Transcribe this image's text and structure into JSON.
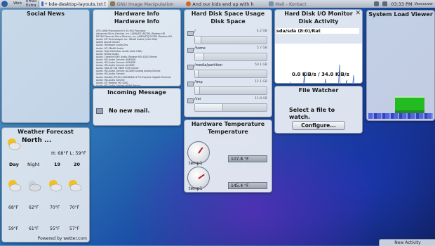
{
  "taskbar": {
    "k_menu": "K Menu",
    "web_label": "Web",
    "email_label": "Email",
    "extra_label": "Extra",
    "tasks": [
      "* kde-desktop-layouts.txt [",
      "GNU Image Manipulation ",
      "And our kids end up with h",
      "Mail - Kontact"
    ],
    "time": "03:33 PM",
    "location": "Vancouver"
  },
  "social_news": {
    "title": "Social News"
  },
  "hardware_info": {
    "titles": [
      "Hardware Info",
      "Hardware Info"
    ],
    "lines": [
      "CPU:    AMD Phenom(tm) II X4 945 Processor",
      "         Advanced Micro Devices, Inc. [AMD/ATI] RS780 (Radeon HD",
      "         RS780 Ethernet Micro Devices, Inc. [AMD/ATI] RS780 (Radeon HD",
      "Audio:  ATI Technologies Inc. SBx00 Azalia (Intel HDA)",
      "         Azalia Sound Device",
      "Audio:  Hardware Audio Dev",
      "Audio:  ATI SBx00 Azalia",
      "Audio:  High Definition Audio (Intel HDA)",
      "Audio:  Nvidia Audio",
      "Audio:  Creative EMU Audio (Radeon HD 4200) Series",
      "Audio:  HD-Audio Generic HDMI/DP",
      "Audio:  HD-Audio Generic HDMI/DP",
      "Audio:  HD-Audio Generic ALC889",
      "Audio:  HDA ATI SB HDMI PCM Device",
      "Audio:  HD-Audio Generic ALC889 Analog analog Device",
      "Audio:  HD-Audio Generic",
      "Audio:  Realtek RTL8111/8168/8411 PCI Express Gigabit Ethernet",
      "Audio:  HD-Audio Generic",
      "Audio:  ATI Radeon HD 4200",
      "Audio:  HD-Audio Generic HDMI Device",
      "Audio:  HD-Audio Generic"
    ]
  },
  "disk_space": {
    "titles": [
      "Hard Disk Space Usage",
      "Disk Space"
    ],
    "rows": [
      {
        "name": "/",
        "value": "4.2 GB",
        "used": 0.08
      },
      {
        "name": "/home",
        "value": "5.7 GB",
        "used": 0.12
      },
      {
        "name": "/media/partition",
        "value": "50.1 GB",
        "used": 0.0
      },
      {
        "name": "/tmp",
        "value": "12.1 GB",
        "used": 0.06
      },
      {
        "name": "/var",
        "value": "11.8 GB",
        "used": 0.38
      }
    ]
  },
  "disk_io": {
    "titles": [
      "Hard Disk I/O Monitor",
      "Disk Activity"
    ],
    "close": "✕",
    "device": "sda/sda (8:0)/Rat",
    "rate": "0.0 KiB/s / 34.0 KiB/s"
  },
  "system_load": {
    "title": "System Load Viewer"
  },
  "incoming_message": {
    "title": "Incoming Message",
    "text": "No new mail."
  },
  "file_watcher": {
    "title": "File Watcher",
    "message": "Select a file to watch.",
    "button": "Configure..."
  },
  "hw_temp": {
    "titles": [
      "Hardware Temperature",
      "Temperature"
    ],
    "sensors": [
      {
        "name": "temp1",
        "value": "107.8 °F"
      },
      {
        "name": "temp1",
        "value": "145.4 °F"
      }
    ]
  },
  "weather": {
    "title": "Weather Forecast",
    "location": "North ...",
    "hilo": "H: 68°F  L: 59°F",
    "days": [
      "Day",
      "Night",
      "19",
      "20"
    ],
    "highs": [
      "68°F",
      "62°F",
      "70°F",
      "70°F"
    ],
    "lows": [
      "59°F",
      "61°F",
      "55°F",
      "57°F"
    ],
    "footer": "Powered by wetter.com"
  },
  "panel": {
    "new_activity": "New Activity"
  },
  "colors": {
    "widget_bg": "#ecf0f5",
    "load_green": "#22bb22",
    "load_blue": "#3355cc"
  }
}
